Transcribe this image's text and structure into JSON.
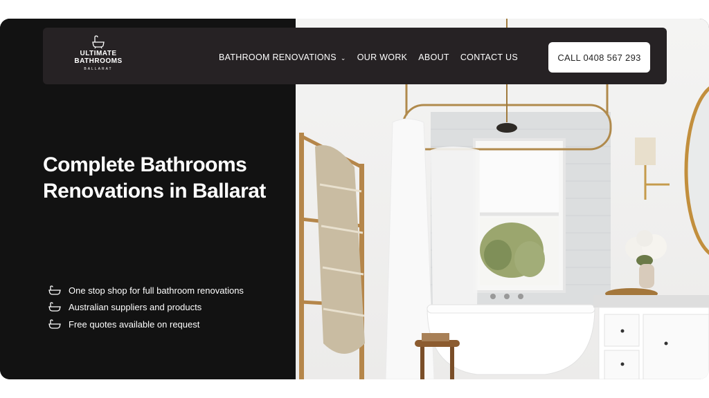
{
  "logo": {
    "line1": "ULTIMATE",
    "line2": "BATHROOMS",
    "line3": "BALLARAT"
  },
  "nav": {
    "items": [
      {
        "label": "BATHROOM RENOVATIONS",
        "has_dropdown": true
      },
      {
        "label": "OUR WORK"
      },
      {
        "label": "ABOUT"
      },
      {
        "label": "CONTACT US"
      }
    ],
    "cta": "CALL 0408 567 293"
  },
  "hero": {
    "headline": "Complete Bathrooms Renovations in Ballarat",
    "features": [
      "One stop shop for full bathroom renovations",
      "Australian suppliers and products",
      "Free quotes available on request"
    ]
  },
  "colors": {
    "background": "#121212",
    "nav_bg": "#262224",
    "cta_bg": "#ffffff",
    "text": "#ffffff"
  },
  "icons": {
    "feature": "bathtub-icon",
    "logo": "bathtub-icon",
    "dropdown": "chevron-down-icon"
  }
}
